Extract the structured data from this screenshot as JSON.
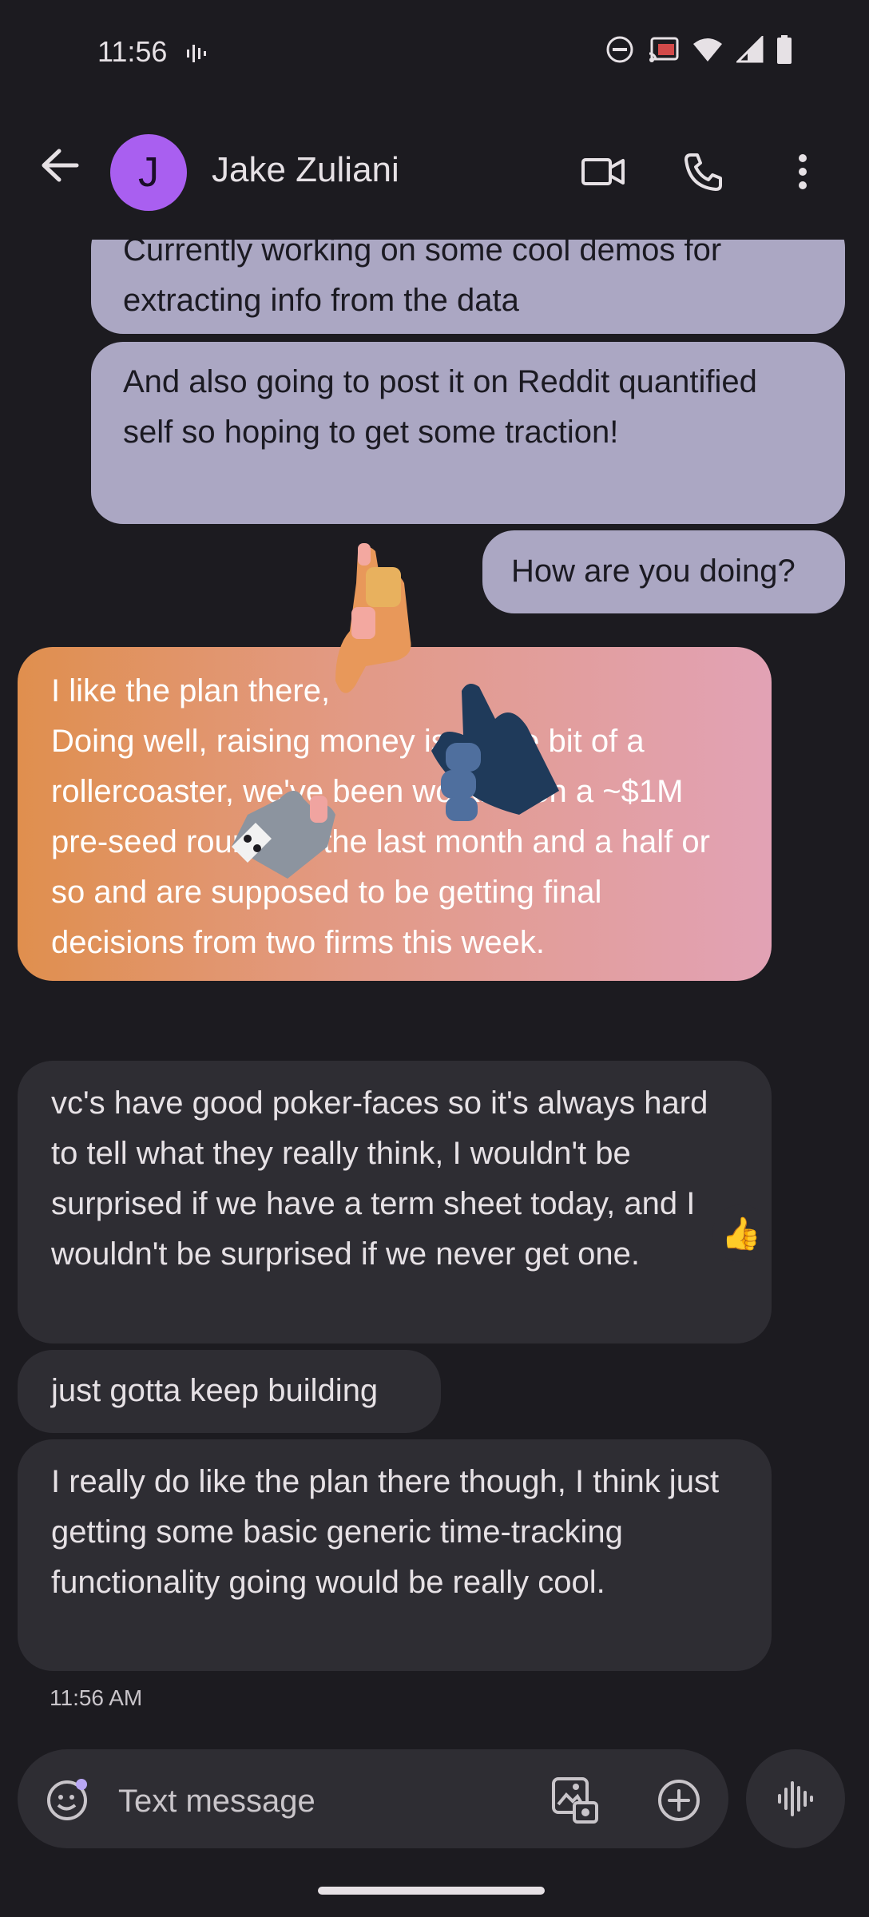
{
  "status_bar": {
    "time": "11:56"
  },
  "app_bar": {
    "avatar_letter": "J",
    "contact_name": "Jake Zuliani"
  },
  "messages": [
    {
      "id": "m1",
      "direction": "outgoing",
      "text": "Currently working on some cool demos for extracting info from the data"
    },
    {
      "id": "m2",
      "direction": "outgoing",
      "text": "And also going to post it on Reddit quantified self so hoping to get some traction!"
    },
    {
      "id": "m3",
      "direction": "outgoing",
      "text": "How are you doing?"
    },
    {
      "id": "m4",
      "direction": "incoming",
      "text": "I like the plan there,\nDoing well, raising money is a little bit of a rollercoaster, we've been working on a ~$1M pre-seed round for the last month and a half or so and are supposed to be getting final decisions from two firms this week.",
      "reaction": "👍"
    },
    {
      "id": "m5",
      "direction": "incoming",
      "text": "vc's have good poker-faces so it's always hard to tell what they really think, I wouldn't be surprised if we have a term sheet today, and I wouldn't be surprised if we never get one."
    },
    {
      "id": "m6",
      "direction": "incoming",
      "text": "just gotta keep building"
    },
    {
      "id": "m7",
      "direction": "incoming",
      "text": "I really do like the plan there though, I think just getting some basic generic time-tracking functionality going would be really cool."
    }
  ],
  "last_timestamp": "11:56 AM",
  "compose": {
    "placeholder": "Text message"
  },
  "colors": {
    "avatar": "#a95ff0",
    "outgoing_bubble": "#aba7c3",
    "incoming_bubble": "#2e2d33",
    "background": "#1c1b20"
  },
  "icons": [
    "back-arrow-icon",
    "video-call-icon",
    "phone-icon",
    "more-vert-icon",
    "emoji-icon",
    "gallery-icon",
    "add-icon",
    "voice-icon",
    "thumbs-up-icon"
  ]
}
